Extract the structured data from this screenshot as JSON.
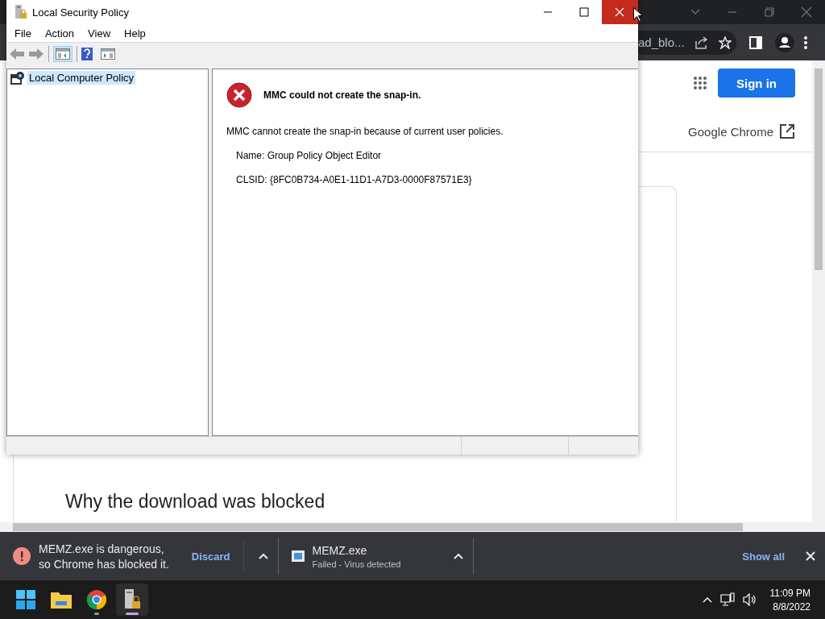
{
  "browser": {
    "address_fragment": "ad_blo...",
    "sign_in": "Sign in",
    "open_link": "Google Chrome",
    "heading": "Why the download was blocked"
  },
  "downloads": {
    "items": [
      {
        "kind": "blocked",
        "lines": [
          "MEMZ.exe is dangerous,",
          "so Chrome has blocked it."
        ],
        "action": "Discard"
      },
      {
        "kind": "failed",
        "lines": [
          "MEMZ.exe",
          "Failed - Virus detected"
        ]
      }
    ],
    "show_all": "Show all"
  },
  "mmc": {
    "title": "Local Security Policy",
    "menu": [
      "File",
      "Action",
      "View",
      "Help"
    ],
    "tree": [
      {
        "label": "Local Computer Policy",
        "selected": true
      }
    ],
    "error": {
      "title": "MMC could not create the snap-in.",
      "message": "MMC cannot create the snap-in because of current user policies.",
      "details": [
        "Name: Group Policy Object Editor",
        "CLSID: {8FC0B734-A0E1-11D1-A7D3-0000F87571E3}"
      ]
    }
  },
  "taskbar": {
    "apps": [
      {
        "kind": "start",
        "selected": false,
        "running": false
      },
      {
        "kind": "explorer",
        "selected": false,
        "running": false
      },
      {
        "kind": "chrome",
        "selected": false,
        "running": true
      },
      {
        "kind": "policy",
        "selected": true,
        "running": true
      }
    ],
    "time": "11:09 PM",
    "date": "8/8/2022"
  }
}
